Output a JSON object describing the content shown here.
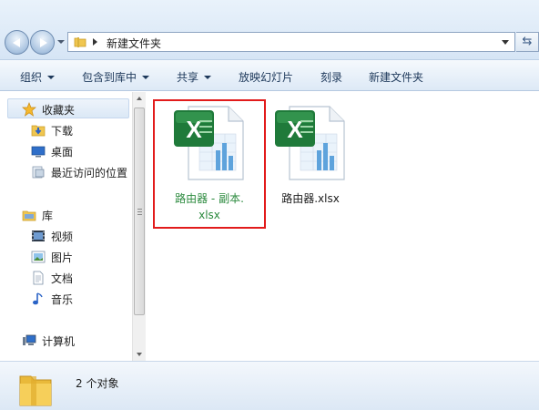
{
  "address": {
    "path": "新建文件夹"
  },
  "toolbar": {
    "items": [
      {
        "label": "组织",
        "dropdown": true
      },
      {
        "label": "包含到库中",
        "dropdown": true
      },
      {
        "label": "共享",
        "dropdown": true
      },
      {
        "label": "放映幻灯片",
        "dropdown": false
      },
      {
        "label": "刻录",
        "dropdown": false
      },
      {
        "label": "新建文件夹",
        "dropdown": false
      }
    ]
  },
  "nav": {
    "favorites": {
      "label": "收藏夹",
      "icon": "star-icon"
    },
    "favorite_items": [
      {
        "label": "下载",
        "icon": "download-folder-icon"
      },
      {
        "label": "桌面",
        "icon": "desktop-icon"
      },
      {
        "label": "最近访问的位置",
        "icon": "recent-places-icon"
      }
    ],
    "libraries": {
      "label": "库",
      "icon": "library-icon"
    },
    "library_items": [
      {
        "label": "视频",
        "icon": "video-icon"
      },
      {
        "label": "图片",
        "icon": "pictures-icon"
      },
      {
        "label": "文档",
        "icon": "documents-icon"
      },
      {
        "label": "音乐",
        "icon": "music-icon"
      }
    ],
    "computer": {
      "label": "计算机",
      "icon": "computer-icon"
    }
  },
  "files": [
    {
      "name_line1": "路由器 - 副本.",
      "name_line2": "xlsx",
      "icon": "excel-file-icon",
      "selected": true
    },
    {
      "name_line1": "路由器.xlsx",
      "name_line2": "",
      "icon": "excel-file-icon",
      "selected": false
    }
  ],
  "status": {
    "count_text": "2 个对象"
  },
  "colors": {
    "highlight_box": "#e21b1b",
    "selected_label": "#2b8a3e",
    "excel_green": "#1f7a3a"
  }
}
